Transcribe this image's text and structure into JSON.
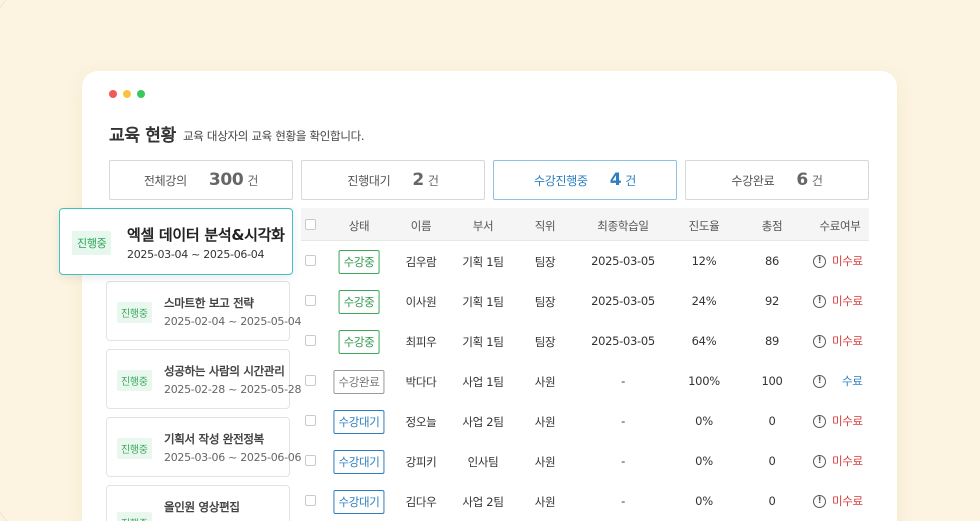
{
  "colors": {
    "background": "#fcf4e0",
    "accent": "#2d7fc1",
    "in_progress_green": "#3aa957",
    "warning_red": "#d93b3b",
    "featured_border": "#3ec2c2"
  },
  "window": {
    "dots": [
      "#ef5b5b",
      "#f5c542",
      "#3cc85f"
    ]
  },
  "header": {
    "title": "교육 현황",
    "subtitle": "교육 대상자의 교육 현황을 확인합니다."
  },
  "stats": [
    {
      "label": "전체강의",
      "value": "300",
      "unit": "건"
    },
    {
      "label": "진행대기",
      "value": "2",
      "unit": "건"
    },
    {
      "label": "수강진행중",
      "value": "4",
      "unit": "건"
    },
    {
      "label": "수강완료",
      "value": "6",
      "unit": "건"
    }
  ],
  "courses": [
    {
      "badge": "진행중",
      "name": "엑셀 데이터 분석&시각화",
      "date": "2025-03-04 ~ 2025-06-04"
    },
    {
      "badge": "진행중",
      "name": "스마트한 보고 전략",
      "date": "2025-02-04 ~ 2025-05-04"
    },
    {
      "badge": "진행중",
      "name": "성공하는 사람의 시간관리",
      "date": "2025-02-28 ~ 2025-05-28"
    },
    {
      "badge": "진행중",
      "name": "기획서 작성 완전정복",
      "date": "2025-03-06 ~ 2025-06-06"
    },
    {
      "badge": "진행중",
      "name": "올인원 영상편집",
      "date": ""
    }
  ],
  "table": {
    "headers": {
      "status": "상태",
      "name": "이름",
      "dept": "부서",
      "position": "직위",
      "last_study": "최종학습일",
      "progress": "진도율",
      "score": "총점",
      "completion": "수료여부"
    },
    "rows": [
      {
        "status": "수강중",
        "name": "김우람",
        "dept": "기획 1팀",
        "position": "팀장",
        "last_study": "2025-03-05",
        "progress": "12%",
        "score": "86",
        "completion": "미수료"
      },
      {
        "status": "수강중",
        "name": "이사원",
        "dept": "기획 1팀",
        "position": "팀장",
        "last_study": "2025-03-05",
        "progress": "24%",
        "score": "92",
        "completion": "미수료"
      },
      {
        "status": "수강중",
        "name": "최피우",
        "dept": "기획 1팀",
        "position": "팀장",
        "last_study": "2025-03-05",
        "progress": "64%",
        "score": "89",
        "completion": "미수료"
      },
      {
        "status": "수강완료",
        "name": "박다다",
        "dept": "사업 1팀",
        "position": "사원",
        "last_study": "-",
        "progress": "100%",
        "score": "100",
        "completion": "수료"
      },
      {
        "status": "수강대기",
        "name": "정오늘",
        "dept": "사업 2팀",
        "position": "사원",
        "last_study": "-",
        "progress": "0%",
        "score": "0",
        "completion": "미수료"
      },
      {
        "status": "수강대기",
        "name": "강피키",
        "dept": "인사팀",
        "position": "사원",
        "last_study": "-",
        "progress": "0%",
        "score": "0",
        "completion": "미수료"
      },
      {
        "status": "수강대기",
        "name": "김다우",
        "dept": "사업 2팀",
        "position": "사원",
        "last_study": "-",
        "progress": "0%",
        "score": "0",
        "completion": "미수료"
      }
    ]
  }
}
